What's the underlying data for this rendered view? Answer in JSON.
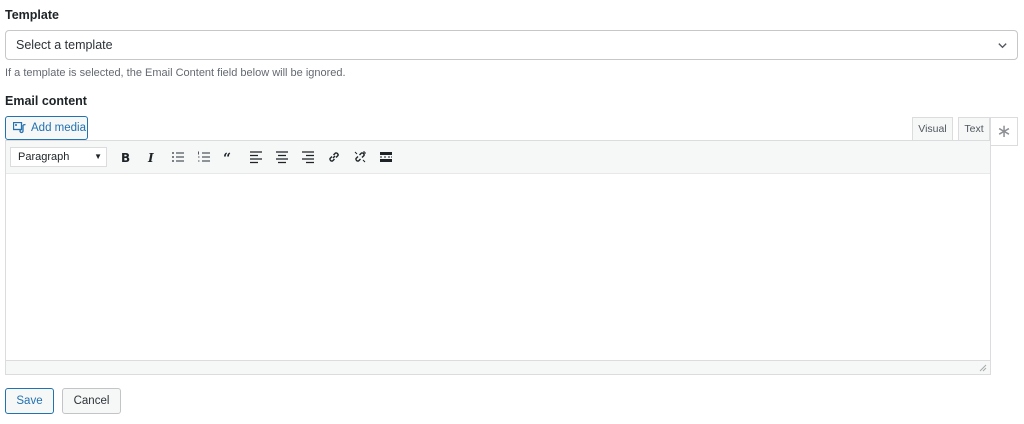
{
  "template": {
    "label": "Template",
    "select_value": "Select a template",
    "help": "If a template is selected, the Email Content field below will be ignored."
  },
  "email_content": {
    "label": "Email content",
    "add_media_label": "Add media",
    "tabs": {
      "visual": "Visual",
      "text": "Text"
    },
    "expand_glyph": "∗",
    "format_value": "Paragraph",
    "toolbar_icons": [
      "bold-icon",
      "italic-icon",
      "bullet-list-icon",
      "numbered-list-icon",
      "blockquote-icon",
      "align-left-icon",
      "align-center-icon",
      "align-right-icon",
      "link-icon",
      "unlink-icon",
      "read-more-icon"
    ]
  },
  "actions": {
    "save_label": "Save",
    "cancel_label": "Cancel"
  },
  "colors": {
    "accent": "#2271b1",
    "border": "#dcdcde",
    "toolbar_bg": "#f6f7f7"
  }
}
